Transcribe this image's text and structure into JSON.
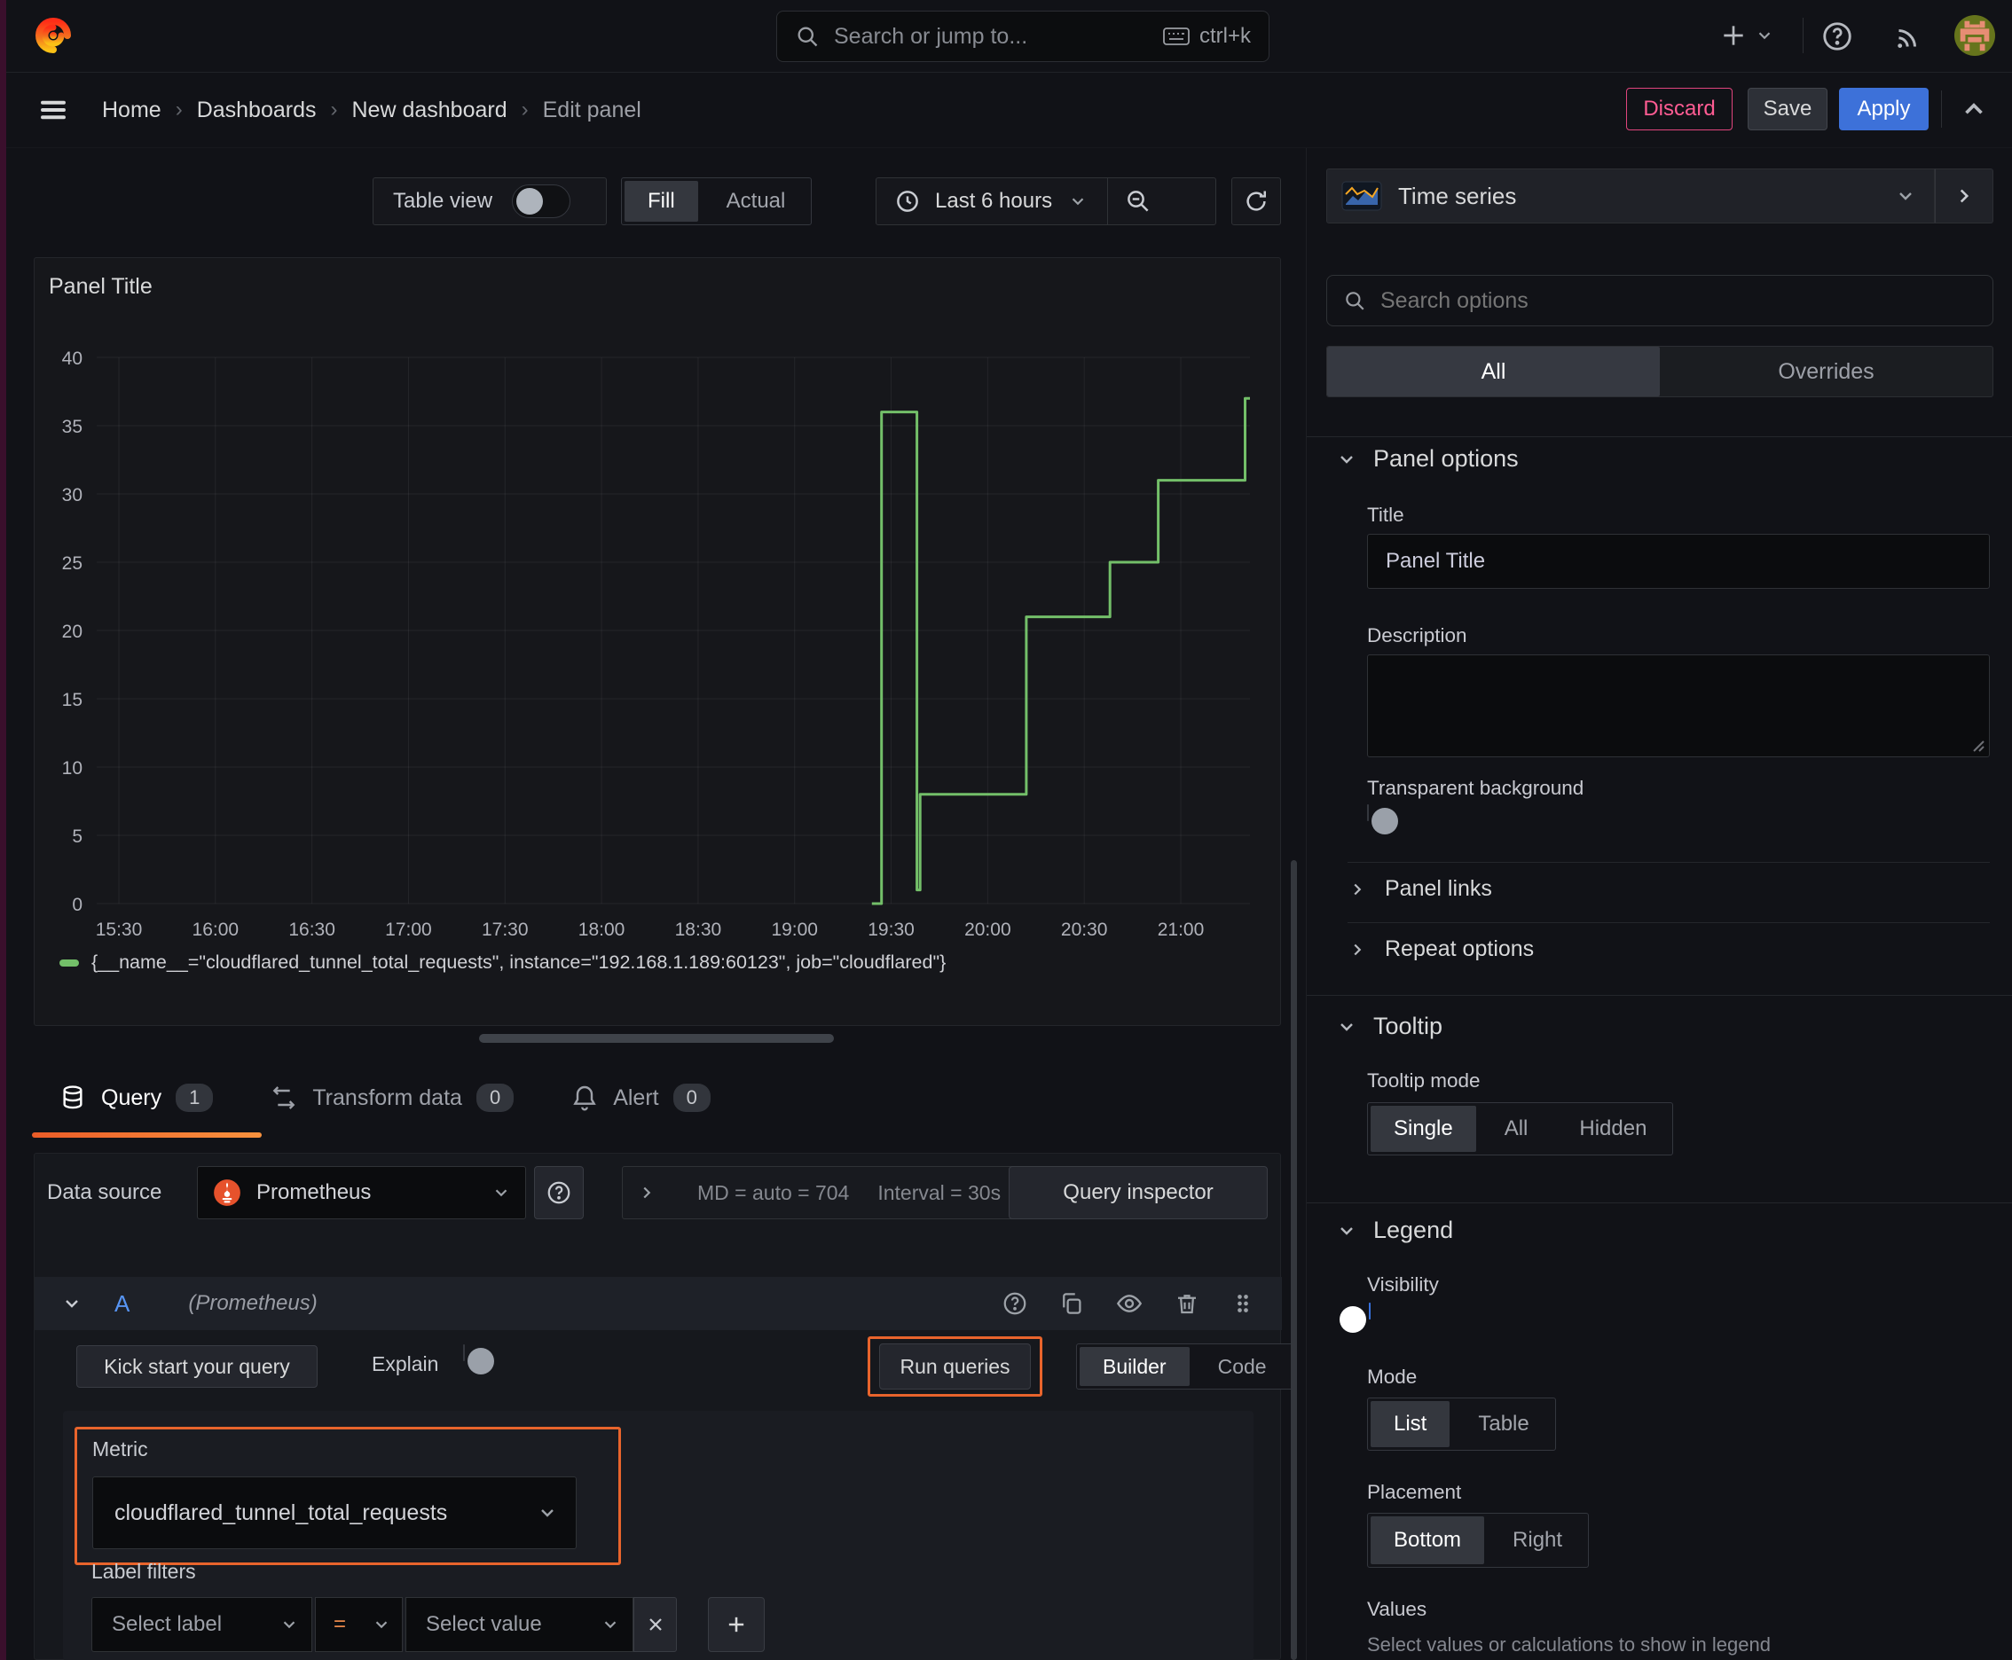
{
  "topbar": {
    "search_placeholder": "Search or jump to...",
    "shortcut": "ctrl+k"
  },
  "nav": {
    "breadcrumb": [
      "Home",
      "Dashboards",
      "New dashboard",
      "Edit panel"
    ],
    "discard": "Discard",
    "save": "Save",
    "apply": "Apply"
  },
  "toolbar": {
    "table_view": "Table view",
    "fill": "Fill",
    "actual": "Actual",
    "time_range": "Last 6 hours"
  },
  "chart": {
    "panel_title": "Panel Title",
    "legend": "{__name__=\"cloudflared_tunnel_total_requests\", instance=\"192.168.1.189:60123\", job=\"cloudflared\"}"
  },
  "chart_data": {
    "type": "line",
    "title": "Panel Title",
    "step": true,
    "x_ticks": [
      "15:30",
      "16:00",
      "16:30",
      "17:00",
      "17:30",
      "18:00",
      "18:30",
      "19:00",
      "19:30",
      "20:00",
      "20:30",
      "21:00"
    ],
    "x_range": [
      "15:23",
      "21:21"
    ],
    "y_ticks": [
      0,
      5,
      10,
      15,
      20,
      25,
      30,
      35,
      40
    ],
    "ylim": [
      0,
      40
    ],
    "grid": true,
    "legend_position": "bottom",
    "series": [
      {
        "name": "{__name__=\"cloudflared_tunnel_total_requests\", instance=\"192.168.1.189:60123\", job=\"cloudflared\"}",
        "color": "#73bf69",
        "points": [
          [
            "19:24",
            0
          ],
          [
            "19:27",
            36
          ],
          [
            "19:38",
            1
          ],
          [
            "19:39",
            8
          ],
          [
            "20:12",
            21
          ],
          [
            "20:38",
            25
          ],
          [
            "20:53",
            31
          ],
          [
            "21:20",
            37
          ]
        ]
      }
    ]
  },
  "tabs": {
    "query": "Query",
    "query_count": "1",
    "transform": "Transform data",
    "transform_count": "0",
    "alert": "Alert",
    "alert_count": "0"
  },
  "datasource": {
    "label": "Data source",
    "name": "Prometheus",
    "stats_md": "MD = auto = 704",
    "stats_interval": "Interval = 30s",
    "inspector": "Query inspector"
  },
  "query": {
    "ref": "A",
    "hint": "(Prometheus)",
    "kickstart": "Kick start your query",
    "explain": "Explain",
    "run": "Run queries",
    "builder": "Builder",
    "code": "Code",
    "metric_label": "Metric",
    "metric_value": "cloudflared_tunnel_total_requests",
    "filters_label": "Label filters",
    "select_label": "Select label",
    "operator": "=",
    "select_value": "Select value"
  },
  "options": {
    "viz": "Time series",
    "search_placeholder": "Search options",
    "all": "All",
    "overrides": "Overrides",
    "panel_options": "Panel options",
    "title_label": "Title",
    "title_value": "Panel Title",
    "description_label": "Description",
    "transparent_label": "Transparent background",
    "panel_links": "Panel links",
    "repeat_options": "Repeat options",
    "tooltip": "Tooltip",
    "tooltip_mode": "Tooltip mode",
    "mode_single": "Single",
    "mode_all": "All",
    "mode_hidden": "Hidden",
    "legend": "Legend",
    "visibility": "Visibility",
    "mode": "Mode",
    "mode_list": "List",
    "mode_table": "Table",
    "placement": "Placement",
    "placement_bottom": "Bottom",
    "placement_right": "Right",
    "values": "Values",
    "values_hint": "Select values or calculations to show in legend"
  },
  "colors": {
    "accent_orange": "#e8642c",
    "series_green": "#73bf69",
    "primary_blue": "#3d71d9",
    "danger_pink": "#e0457d"
  }
}
